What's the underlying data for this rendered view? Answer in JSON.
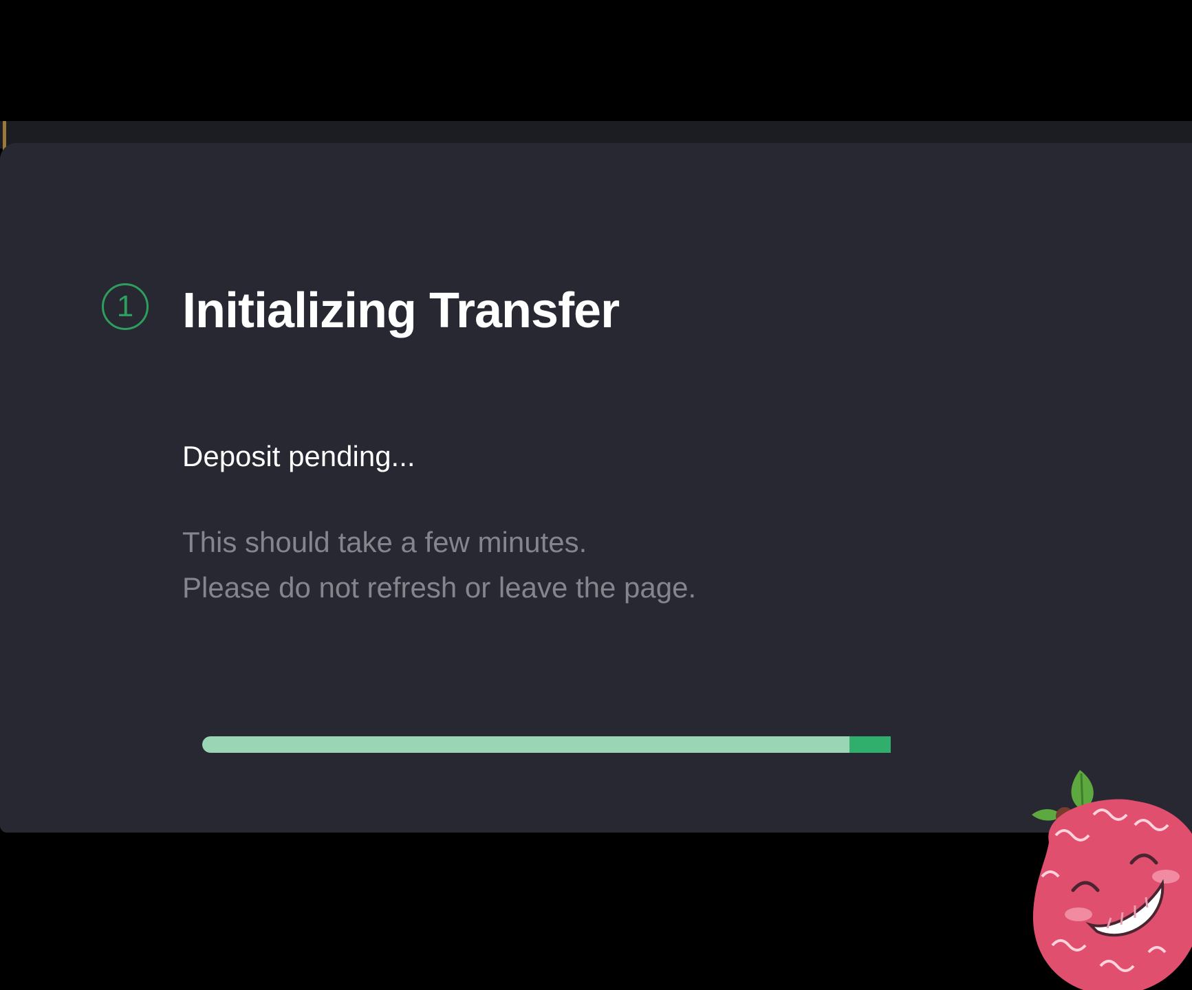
{
  "transfer": {
    "step_number": "1",
    "title": "Initializing Transfer",
    "status": "Deposit pending...",
    "note_line_1": "This should take a few minutes.",
    "note_line_2": "Please do not refresh or leave the page.",
    "progress_fraction": 0.94
  },
  "colors": {
    "background": "#000000",
    "card": "#282833",
    "accent_green": "#2e9e5e",
    "progress_light": "#9ad6b6",
    "progress_dark": "#2fae6c",
    "muted_text": "#85858d",
    "mascot_pink": "#e0506e"
  },
  "icons": {
    "step": "circled-number-icon",
    "mascot": "raspberry-mascot-icon"
  }
}
